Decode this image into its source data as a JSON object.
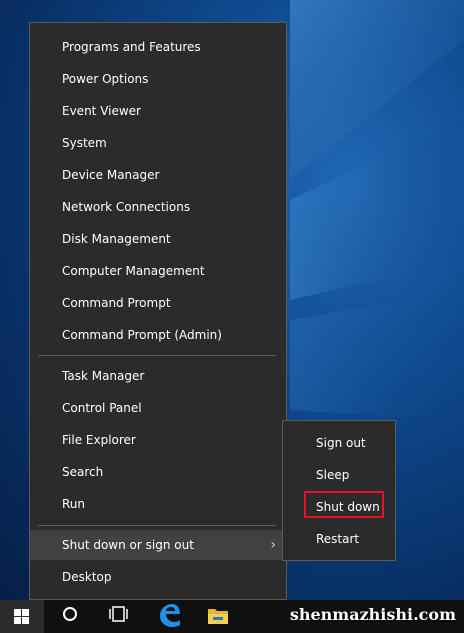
{
  "menu": {
    "items": [
      {
        "label": "Programs and Features"
      },
      {
        "label": "Power Options"
      },
      {
        "label": "Event Viewer"
      },
      {
        "label": "System"
      },
      {
        "label": "Device Manager"
      },
      {
        "label": "Network Connections"
      },
      {
        "label": "Disk Management"
      },
      {
        "label": "Computer Management"
      },
      {
        "label": "Command Prompt"
      },
      {
        "label": "Command Prompt (Admin)"
      },
      {
        "label": "Task Manager"
      },
      {
        "label": "Control Panel"
      },
      {
        "label": "File Explorer"
      },
      {
        "label": "Search"
      },
      {
        "label": "Run"
      },
      {
        "label": "Shut down or sign out"
      },
      {
        "label": "Desktop"
      }
    ],
    "chevron": "›"
  },
  "submenu": {
    "items": [
      {
        "label": "Sign out"
      },
      {
        "label": "Sleep"
      },
      {
        "label": "Shut down"
      },
      {
        "label": "Restart"
      }
    ]
  },
  "taskbar": {
    "icons": [
      "windows-start-icon",
      "cortana-circle-icon",
      "task-view-icon",
      "edge-icon",
      "file-explorer-icon"
    ]
  },
  "watermark": "shenmazhishi.com",
  "colors": {
    "menu_bg": "#2b2b2b",
    "highlight": "#414141",
    "highlight_box": "#e81123",
    "taskbar_bg": "#101010"
  }
}
